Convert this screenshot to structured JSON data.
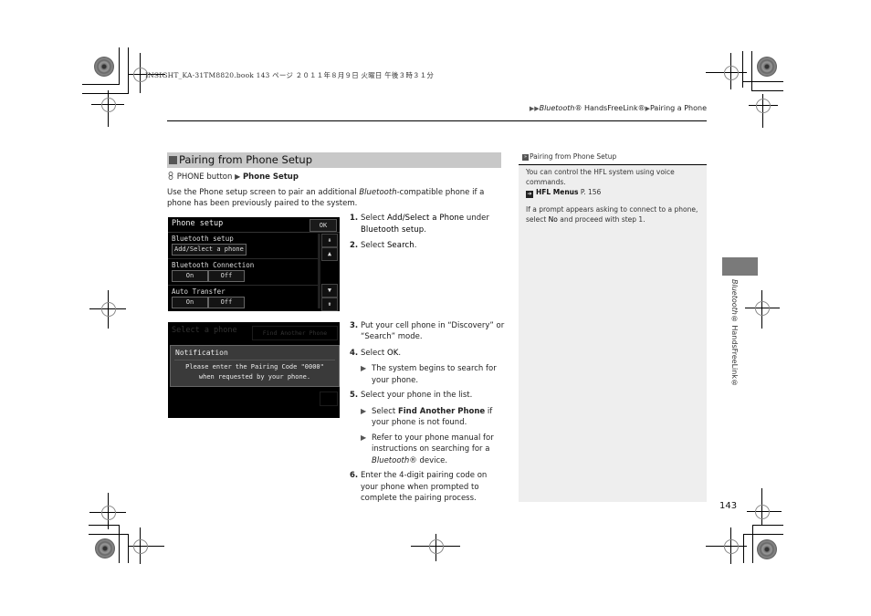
{
  "print_header": {
    "text": "INSIGHT_KA-31TM8820.book  143 ページ  ２０１１年８月９日  火曜日  午後３時３１分"
  },
  "breadcrumb": {
    "arrow": "▶▶",
    "part1_italic": "Bluetooth",
    "part1_rest": "® HandsFreeLink®",
    "sep": "▶",
    "part2": "Pairing a Phone"
  },
  "section": {
    "title": "Pairing from Phone Setup",
    "nav_icon": "phone-button-icon",
    "nav_prefix": "PHONE button",
    "nav_arrow": "▶",
    "nav_target": "Phone Setup",
    "intro_before": "Use the Phone setup screen to pair an additional ",
    "intro_italic": "Bluetooth",
    "intro_after": "-compatible phone if a phone has been previously paired to the system."
  },
  "screen1": {
    "title": "Phone setup",
    "ok_label": "OK",
    "group1_label": "Bluetooth setup",
    "group1_button": "Add/Select a phone",
    "group2_label": "Bluetooth Connection",
    "group2_on": "On",
    "group2_off": "Off",
    "group3_label": "Auto Transfer",
    "group3_on": "On",
    "group3_off": "Off",
    "scroll_top": "⇞",
    "scroll_up": "▲",
    "scroll_down": "▼",
    "scroll_bottom": "⇟"
  },
  "screen2": {
    "bg_title": "Select a phone",
    "bg_button": "Find Another Phone",
    "notif_title": "Notification",
    "notif_line1": "Please enter the Pairing Code \"0000\"",
    "notif_line2": "when requested by your phone."
  },
  "steps": [
    {
      "num": "1.",
      "t1": "Select ",
      "b1": "Add/Select a Phone",
      "t2": " under ",
      "b2": "Bluetooth setup",
      "t3": "."
    },
    {
      "num": "2.",
      "t1": "Select ",
      "b1": "Search",
      "t2": "."
    },
    {
      "num": "3.",
      "t1": "Put your cell phone in “Discovery” or “Search” mode."
    },
    {
      "num": "4.",
      "t1": "Select ",
      "b1": "OK",
      "t2": "."
    },
    {
      "num": "5.",
      "t1": "Select your phone in the list."
    },
    {
      "num": "6.",
      "t1": "Enter the 4-digit pairing code on your phone when prompted to complete the pairing process."
    }
  ],
  "substeps": {
    "s4a": "The system begins to search for your phone.",
    "s5a_t1": "Select ",
    "s5a_b": "Find Another Phone",
    "s5a_t2": " if your phone is not found.",
    "s5b_t1": "Refer to your phone manual for instructions on searching for a ",
    "s5b_i": "Bluetooth",
    "s5b_t2": "® device.",
    "arrow": "▶"
  },
  "note": {
    "header": "Pairing from Phone Setup",
    "p1": "You can control the HFL system using voice commands.",
    "ref_label": "HFL Menus",
    "ref_page": " P. 156",
    "p2_t1": "If a prompt appears asking to connect to a phone, select ",
    "p2_b": "No",
    "p2_t2": " and proceed with step 1."
  },
  "side_label": {
    "italic": "Bluetooth",
    "rest": "® HandsFreeLink®"
  },
  "page_number": "143"
}
